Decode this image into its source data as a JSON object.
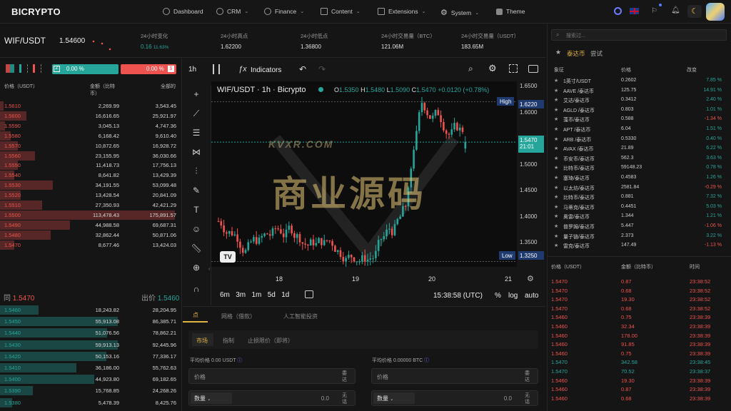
{
  "brand": "BICRYPTO",
  "nav": {
    "items": [
      "Dashboard",
      "CRM",
      "Finance",
      "Content",
      "Extensions",
      "System",
      "Theme"
    ]
  },
  "ticker": {
    "pair": "WIF/USDT",
    "price": "1.54600",
    "change_label": "24小时变化",
    "change_value": "0.16",
    "change_pct": "11.63%",
    "high_label": "24小时高点",
    "high_value": "1.62200",
    "low_label": "24小时低点",
    "low_value": "1.36800",
    "vol_btc_label": "24小时交易量（BTC）",
    "vol_btc_value": "121.06M",
    "vol_usdt_label": "24小时交易量（USDT）",
    "vol_usdt_value": "183.65M"
  },
  "orderbook": {
    "ask_pct": "0.00 %",
    "bid_pct": "0.00 %",
    "header": {
      "price": "价格（USDT）",
      "amount": "金额（比特币）",
      "total": "全部的"
    },
    "asks": [
      {
        "price": "1.5610",
        "amount": "2,269.99",
        "total": "3,543.45",
        "depth": 0.02
      },
      {
        "price": "1.5600",
        "amount": "16,616.65",
        "total": "25,921.97",
        "depth": 0.15
      },
      {
        "price": "1.5590",
        "amount": "3,045.13",
        "total": "4,747.36",
        "depth": 0.03
      },
      {
        "price": "1.5580",
        "amount": "6,168.42",
        "total": "9,610.40",
        "depth": 0.06
      },
      {
        "price": "1.5570",
        "amount": "10,872.65",
        "total": "16,928.72",
        "depth": 0.1
      },
      {
        "price": "1.5560",
        "amount": "23,155.95",
        "total": "36,030.66",
        "depth": 0.2
      },
      {
        "price": "1.5550",
        "amount": "11,418.73",
        "total": "17,756.13",
        "depth": 0.1
      },
      {
        "price": "1.5540",
        "amount": "8,641.82",
        "total": "13,429.39",
        "depth": 0.08
      },
      {
        "price": "1.5530",
        "amount": "34,191.55",
        "total": "53,099.48",
        "depth": 0.3
      },
      {
        "price": "1.5520",
        "amount": "13,428.54",
        "total": "20,841.09",
        "depth": 0.12
      },
      {
        "price": "1.5510",
        "amount": "27,350.93",
        "total": "42,421.29",
        "depth": 0.24
      },
      {
        "price": "1.5500",
        "amount": "113,478.43",
        "total": "175,891.57",
        "depth": 1.0
      },
      {
        "price": "1.5490",
        "amount": "44,988.58",
        "total": "69,687.31",
        "depth": 0.4
      },
      {
        "price": "1.5480",
        "amount": "32,862.44",
        "total": "50,871.06",
        "depth": 0.29
      },
      {
        "price": "1.5470",
        "amount": "8,677.46",
        "total": "13,424.03",
        "depth": 0.08
      }
    ],
    "mid": {
      "bid_label": "同",
      "bid_price": "1.5470",
      "ask_label": "出价",
      "ask_price": "1.5460"
    },
    "bids": [
      {
        "price": "1.5460",
        "amount": "18,243.82",
        "total": "28,204.95",
        "depth": 0.33
      },
      {
        "price": "1.5450",
        "amount": "55,913.08",
        "total": "86,385.71",
        "depth": 1.0
      },
      {
        "price": "1.5440",
        "amount": "51,076.56",
        "total": "78,862.21",
        "depth": 0.91
      },
      {
        "price": "1.5430",
        "amount": "59,913.13",
        "total": "92,445.96",
        "depth": 1.0
      },
      {
        "price": "1.5420",
        "amount": "50,153.16",
        "total": "77,336.17",
        "depth": 0.9
      },
      {
        "price": "1.5410",
        "amount": "36,186.00",
        "total": "55,762.63",
        "depth": 0.65
      },
      {
        "price": "1.5400",
        "amount": "44,923.80",
        "total": "69,182.65",
        "depth": 0.8
      },
      {
        "price": "1.5390",
        "amount": "15,768.85",
        "total": "24,268.26",
        "depth": 0.28
      },
      {
        "price": "1.5380",
        "amount": "5,478.39",
        "total": "8,425.76",
        "depth": 0.1
      }
    ]
  },
  "chart": {
    "interval": "1h",
    "indicators": "Indicators",
    "title": "WIF/USDT · 1h · Bicrypto",
    "o": "1.5350",
    "h": "1.5480",
    "l": "1.5090",
    "c": "1.5470",
    "chg": "+0.0120 (+0.78%)",
    "high_tag": "High",
    "high_val": "1.6220",
    "low_tag": "Low",
    "low_val": "1.3250",
    "last_val": "1.5470",
    "last_time": "21:01",
    "yticks": [
      "1.6500",
      "1.6000",
      "1.5500",
      "1.5000",
      "1.4500",
      "1.4000",
      "1.3500"
    ],
    "xticks": [
      "18",
      "19",
      "20",
      "21"
    ],
    "ranges": [
      "6m",
      "3m",
      "1m",
      "5d",
      "1d"
    ],
    "clock": "15:38:58 (UTC)",
    "pct": "%",
    "log": "log",
    "auto": "auto"
  },
  "watermark": {
    "top": "KVXR.COM",
    "main": "商业源码"
  },
  "trade": {
    "tab_spot": "点",
    "tab_grid": "网格（借款）",
    "tab_ai": "人工智能投资",
    "order_types": [
      "市场",
      "指制",
      "止损限价（即将）"
    ],
    "buy_avg": "平均价格 0.00 USDT",
    "sell_avg": "平均价格 0.00000 BTC",
    "price_ph": "价格",
    "qty_label": "数量",
    "qty_val": "0.0",
    "side_buy": "无话",
    "side_label": "委达"
  },
  "market": {
    "search_placeholder": "搜索过...",
    "tab_fav": "泰达币",
    "tab_other": "尝试",
    "head": {
      "sym": "象征",
      "price": "价格",
      "chg": "改变"
    },
    "rows": [
      {
        "sym": "1英寸/USDT",
        "price": "0.2602",
        "chg": "7.85 %",
        "dir": "up"
      },
      {
        "sym": "AAVE /泰达币",
        "price": "125.75",
        "chg": "14.91 %",
        "dir": "up"
      },
      {
        "sym": "艾达/泰达币",
        "price": "0.3412",
        "chg": "2.40 %",
        "dir": "up"
      },
      {
        "sym": "AGLD /泰达币",
        "price": "0.803",
        "chg": "1.01 %",
        "dir": "up"
      },
      {
        "sym": "藻币/泰达币",
        "price": "0.588",
        "chg": "-1.34 %",
        "dir": "down"
      },
      {
        "sym": "APT /泰达币",
        "price": "6.04",
        "chg": "1.51 %",
        "dir": "up"
      },
      {
        "sym": "ARB /泰达币",
        "price": "0.5330",
        "chg": "0.40 %",
        "dir": "up"
      },
      {
        "sym": "AVAX /泰达币",
        "price": "21.89",
        "chg": "6.22 %",
        "dir": "up"
      },
      {
        "sym": "币安币/泰达币",
        "price": "562.3",
        "chg": "3.63 %",
        "dir": "up"
      },
      {
        "sym": "比特币/泰达币",
        "price": "59148.23",
        "chg": "0.78 %",
        "dir": "up"
      },
      {
        "sym": "塞琦/泰达币",
        "price": "0.4583",
        "chg": "1.26 %",
        "dir": "up"
      },
      {
        "sym": "以太坊/泰达币",
        "price": "2581.84",
        "chg": "-0.29 %",
        "dir": "down"
      },
      {
        "sym": "比特币/泰达币",
        "price": "0.881",
        "chg": "7.32 %",
        "dir": "up"
      },
      {
        "sym": "马蒂克/泰达币",
        "price": "0.4451",
        "chg": "5.03 %",
        "dir": "up"
      },
      {
        "sym": "奥雷/泰达币",
        "price": "1.344",
        "chg": "1.21 %",
        "dir": "up"
      },
      {
        "sym": "普罗姆/泰达币",
        "price": "5.447",
        "chg": "-1.06 %",
        "dir": "down"
      },
      {
        "sym": "量子链/泰达币",
        "price": "2.373",
        "chg": "3.22 %",
        "dir": "up"
      },
      {
        "sym": "雷克/泰达币",
        "price": "147.49",
        "chg": "-1.13 %",
        "dir": "down"
      }
    ]
  },
  "trades": {
    "head": {
      "price": "价格（USDT）",
      "amount": "金额（比特币）",
      "time": "时间"
    },
    "rows": [
      {
        "price": "1.5470",
        "amount": "0.87",
        "time": "23:38:52",
        "dir": "down"
      },
      {
        "price": "1.5470",
        "amount": "0.68",
        "time": "23:38:52",
        "dir": "down"
      },
      {
        "price": "1.5470",
        "amount": "19.30",
        "time": "23:38:52",
        "dir": "down"
      },
      {
        "price": "1.5470",
        "amount": "0.68",
        "time": "23:38:52",
        "dir": "down"
      },
      {
        "price": "1.5460",
        "amount": "0.75",
        "time": "23:38:39",
        "dir": "down"
      },
      {
        "price": "1.5460",
        "amount": "32.34",
        "time": "23:38:39",
        "dir": "down"
      },
      {
        "price": "1.5460",
        "amount": "178.00",
        "time": "23:38:39",
        "dir": "down"
      },
      {
        "price": "1.5460",
        "amount": "91.85",
        "time": "23:38:39",
        "dir": "down"
      },
      {
        "price": "1.5460",
        "amount": "0.75",
        "time": "23:38:39",
        "dir": "down"
      },
      {
        "price": "1.5470",
        "amount": "342.58",
        "time": "23:38:45",
        "dir": "up"
      },
      {
        "price": "1.5470",
        "amount": "70.52",
        "time": "23:38:37",
        "dir": "up"
      },
      {
        "price": "1.5460",
        "amount": "19.30",
        "time": "23:38:39",
        "dir": "down"
      },
      {
        "price": "1.5460",
        "amount": "0.87",
        "time": "23:38:39",
        "dir": "down"
      },
      {
        "price": "1.5460",
        "amount": "0.68",
        "time": "23:38:39",
        "dir": "down"
      }
    ]
  },
  "colors": {
    "up": "#26a69a",
    "down": "#ef5350",
    "accent": "#e0b341"
  }
}
